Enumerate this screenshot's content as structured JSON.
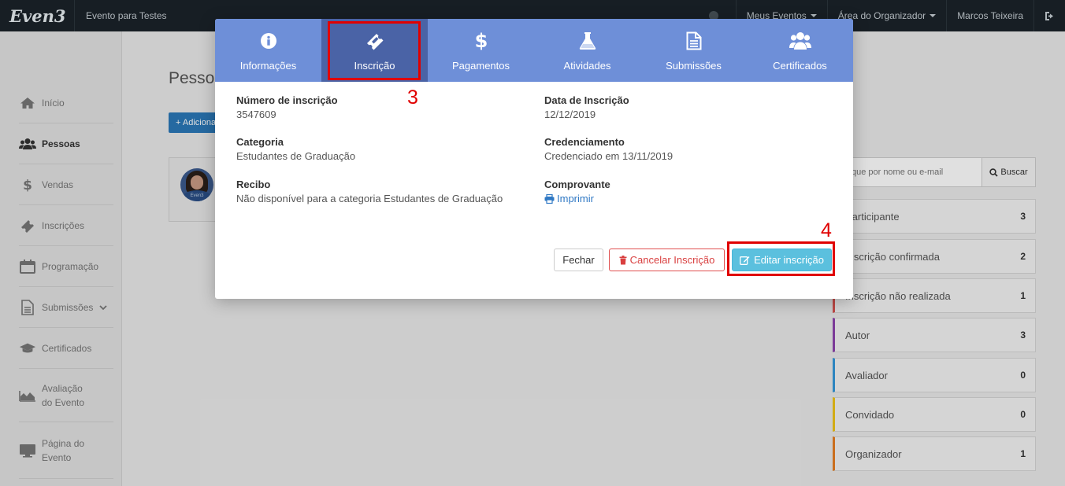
{
  "topbar": {
    "logo": "Even3",
    "event_name": "Evento para Testes",
    "menu_events": "Meus Eventos",
    "menu_organizer": "Área do Organizador",
    "user_name": "Marcos Teixeira",
    "icons": {
      "help": "circle-icon",
      "logout": "sign-out-icon"
    }
  },
  "sidebar": {
    "items": [
      {
        "label": "Início",
        "icon": "home-icon"
      },
      {
        "label": "Pessoas",
        "icon": "users-icon"
      },
      {
        "label": "Vendas",
        "icon": "dollar-icon"
      },
      {
        "label": "Inscrições",
        "icon": "ticket-icon"
      },
      {
        "label": "Programação",
        "icon": "calendar-icon"
      },
      {
        "label": "Submissões",
        "icon": "file-icon"
      },
      {
        "label": "Certificados",
        "icon": "graduation-cap-icon"
      },
      {
        "label": "Avaliação do Evento",
        "icon": "area-chart-icon"
      },
      {
        "label": "Página do Evento",
        "icon": "desktop-icon"
      }
    ]
  },
  "page": {
    "title": "Pessoas",
    "add_button": "+ Adicionar"
  },
  "search": {
    "placeholder": "Busque por nome ou e-mail",
    "button": "Buscar"
  },
  "categories": [
    {
      "label": "Participante",
      "count": "3",
      "color": "#d5d5d5"
    },
    {
      "label": "Inscrição confirmada",
      "count": "2",
      "color": "#d5d5d5"
    },
    {
      "label": "Inscrição não realizada",
      "count": "1",
      "color": "#d9534f"
    },
    {
      "label": "Autor",
      "count": "3",
      "color": "#8e44ad"
    },
    {
      "label": "Avaliador",
      "count": "0",
      "color": "#3498db"
    },
    {
      "label": "Convidado",
      "count": "0",
      "color": "#f0c419"
    },
    {
      "label": "Organizador",
      "count": "1",
      "color": "#e67e22"
    }
  ],
  "modal": {
    "tabs": [
      {
        "label": "Informações",
        "icon": "info-circle-icon"
      },
      {
        "label": "Inscrição",
        "icon": "ticket-icon"
      },
      {
        "label": "Pagamentos",
        "icon": "dollar-icon"
      },
      {
        "label": "Atividades",
        "icon": "flask-icon"
      },
      {
        "label": "Submissões",
        "icon": "file-text-icon"
      },
      {
        "label": "Certificados",
        "icon": "users-icon"
      }
    ],
    "active_tab": "Inscrição",
    "fields": {
      "numero_label": "Número de inscrição",
      "numero_value": "3547609",
      "data_label": "Data de Inscrição",
      "data_value": "12/12/2019",
      "categoria_label": "Categoria",
      "categoria_value": "Estudantes de Graduação",
      "credenciamento_label": "Credenciamento",
      "credenciamento_value": "Credenciado em 13/11/2019",
      "recibo_label": "Recibo",
      "recibo_value": "Não disponível para a categoria Estudantes de Graduação",
      "comprovante_label": "Comprovante",
      "comprovante_link": "Imprimir"
    },
    "buttons": {
      "close": "Fechar",
      "cancel": "Cancelar Inscrição",
      "edit": "Editar inscrição"
    }
  },
  "annotations": {
    "step3": "3",
    "step4": "4",
    "color": "#e00000"
  }
}
